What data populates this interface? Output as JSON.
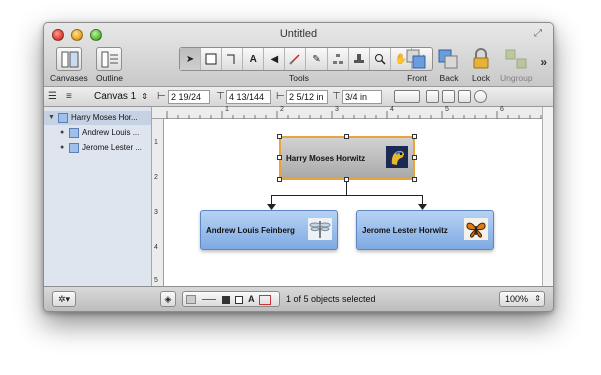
{
  "window": {
    "title": "Untitled"
  },
  "toolbar": {
    "canvases_label": "Canvases",
    "outline_label": "Outline",
    "tools_label": "Tools",
    "front_label": "Front",
    "back_label": "Back",
    "lock_label": "Lock",
    "ungroup_label": "Ungroup",
    "tools": [
      "selection-tool",
      "shape-tool",
      "line-tool",
      "text-tool",
      "style-brush-tool",
      "magnet-tool",
      "pen-tool",
      "diagram-tool",
      "rubber-stamp-tool",
      "zoom-tool",
      "hand-tool",
      "browse-tool"
    ]
  },
  "inspector_bar": {
    "canvas_name": "Canvas 1",
    "x_value": "2 19/24",
    "y_value": "4 13/144",
    "width_value": "2 5/12 in",
    "height_value": "3/4 in"
  },
  "sidebar": {
    "items": [
      {
        "label": "Harry Moses Hor...",
        "level": 0
      },
      {
        "label": "Andrew Louis ...",
        "level": 1
      },
      {
        "label": "Jerome Lester ...",
        "level": 1
      }
    ]
  },
  "ruler": {
    "h_numbers": [
      "1",
      "2",
      "3",
      "4",
      "5",
      "6",
      "7"
    ],
    "v_numbers": [
      "1",
      "2",
      "3",
      "4",
      "5"
    ]
  },
  "diagram": {
    "root": {
      "name": "Harry Moses Horwitz",
      "picture": "parrot-icon"
    },
    "children": [
      {
        "name": "Andrew Louis Feinberg",
        "picture": "dragonfly-icon"
      },
      {
        "name": "Jerome Lester Horwitz",
        "picture": "butterfly-icon"
      }
    ],
    "colors": {
      "root_fill": "#b9b9b9",
      "root_border": "#e7a43a",
      "child_fill": "#9cbfec",
      "child_border": "#5d86c2"
    }
  },
  "statusbar": {
    "selection_text": "1 of 5 objects selected",
    "zoom": "100%"
  }
}
